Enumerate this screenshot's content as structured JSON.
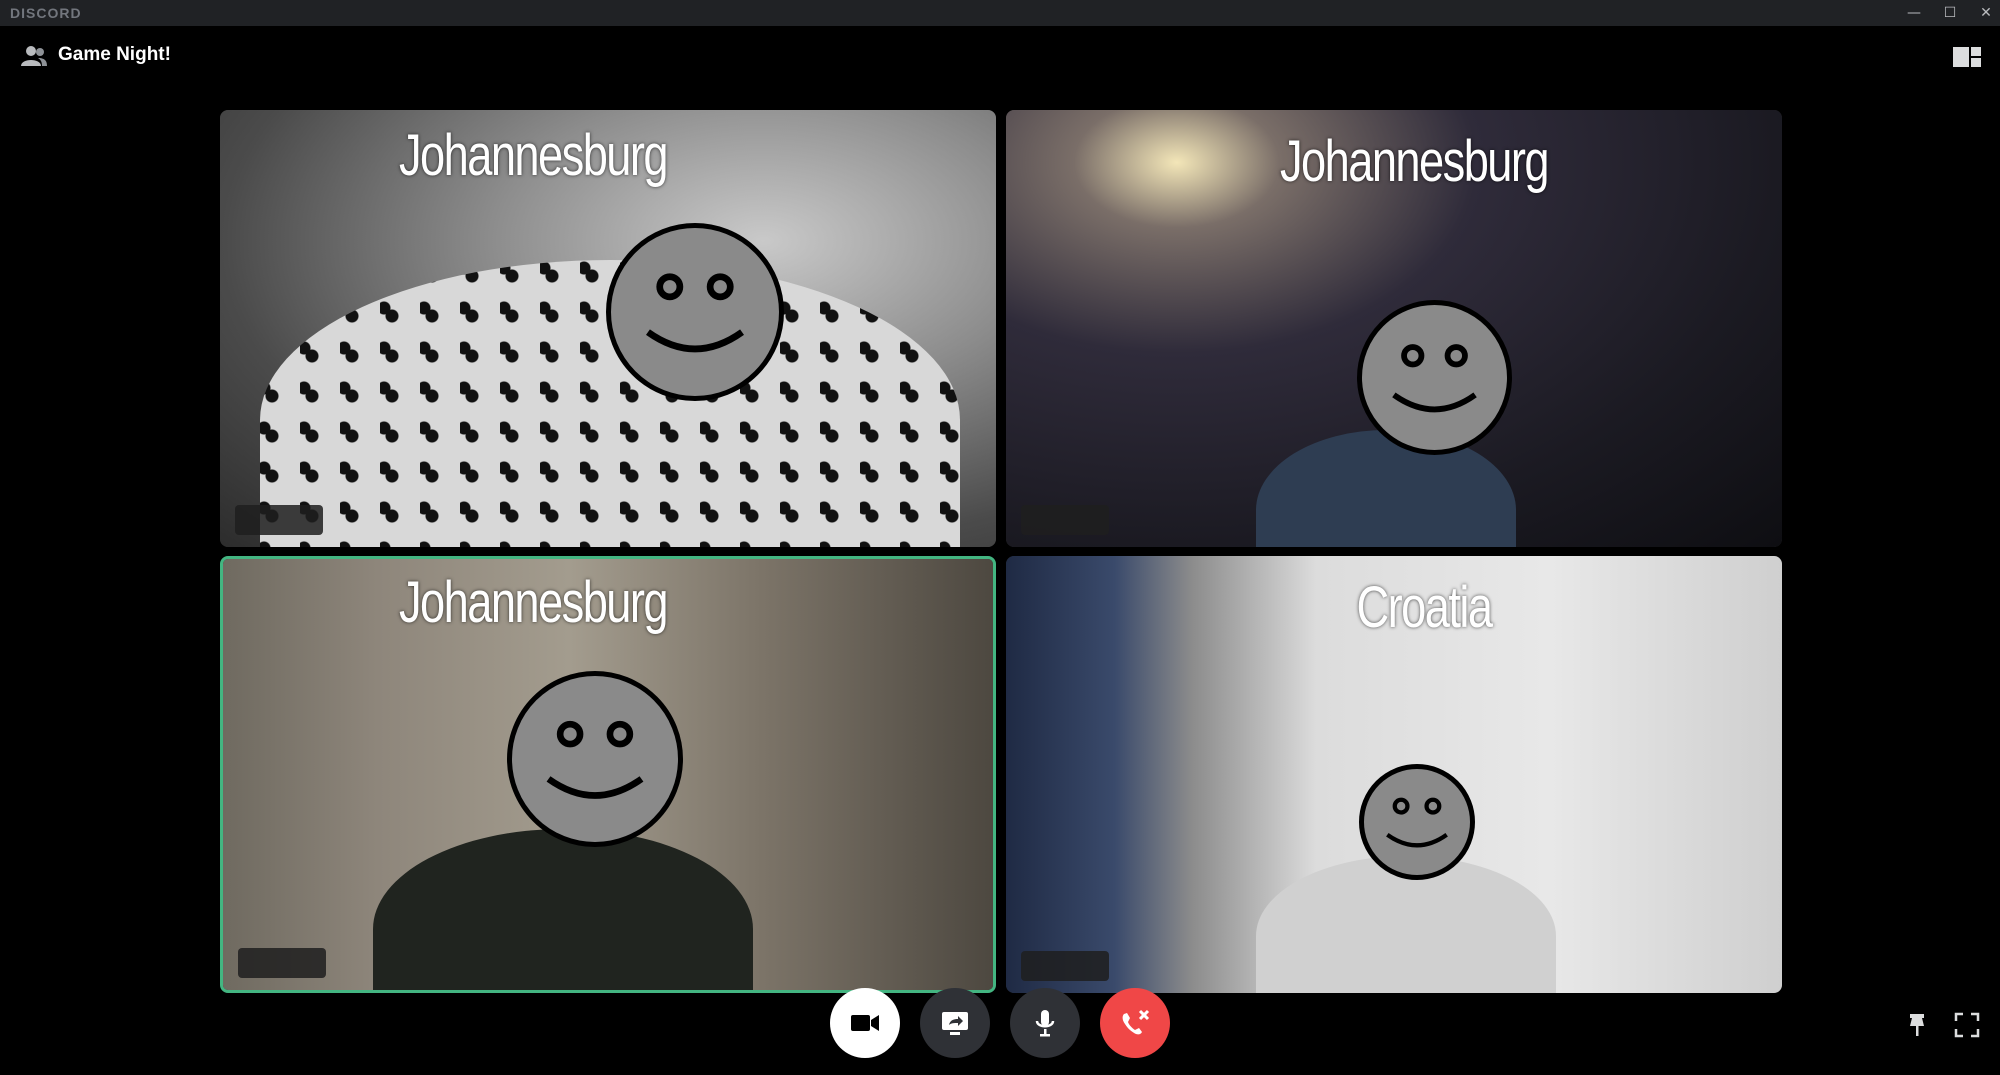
{
  "app": {
    "brand": "DISCORD"
  },
  "window_controls": {
    "minimize": "—",
    "maximize": "☐",
    "close": "✕"
  },
  "header": {
    "channel_name": "Game Night!"
  },
  "tiles": [
    {
      "location": "Johannesburg",
      "speaking": false
    },
    {
      "location": "Johannesburg",
      "speaking": false
    },
    {
      "location": "Johannesburg",
      "speaking": true
    },
    {
      "location": "Croatia",
      "speaking": false
    }
  ],
  "controls": {
    "camera_icon": "video-camera-icon",
    "screen_icon": "screen-share-icon",
    "mic_icon": "microphone-icon",
    "hangup_icon": "disconnect-call-icon"
  },
  "colors": {
    "speaking_border": "#43b581",
    "hangup": "#f04747",
    "control_bg": "#2f3136",
    "titlebar": "#202225"
  }
}
